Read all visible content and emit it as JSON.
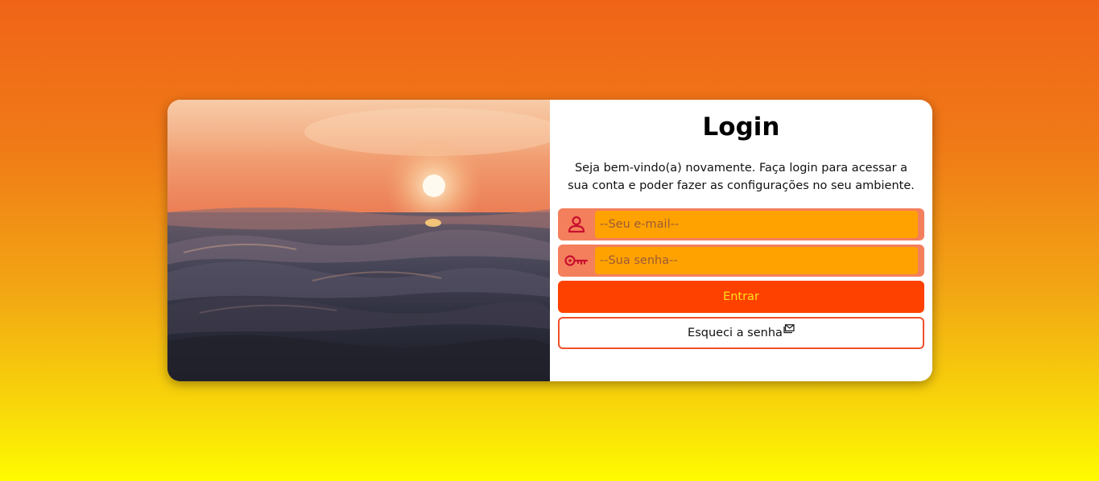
{
  "login": {
    "title": "Login",
    "subtitle": "Seja bem-vindo(a) novamente. Faça login para acessar a sua conta e poder fazer as configurações no seu ambiente.",
    "email_placeholder": "--Seu e-mail--",
    "password_placeholder": "--Sua senha--",
    "submit_label": "Entrar",
    "forgot_label": "Esqueci a senha"
  },
  "icons": {
    "email_field_icon": "user-icon",
    "password_field_icon": "key-icon",
    "forgot_icon": "mail-icon",
    "photo": "sunset-ocean-image"
  },
  "colors": {
    "page_gradient_top": "#f06418",
    "page_gradient_bottom": "#fffb00",
    "field_background": "#f47f5c",
    "input_background": "#ffa200",
    "icon_color": "#c8102e",
    "submit_background": "#ff4100",
    "submit_text": "#ffe01a",
    "forgot_border": "#f0502a"
  }
}
